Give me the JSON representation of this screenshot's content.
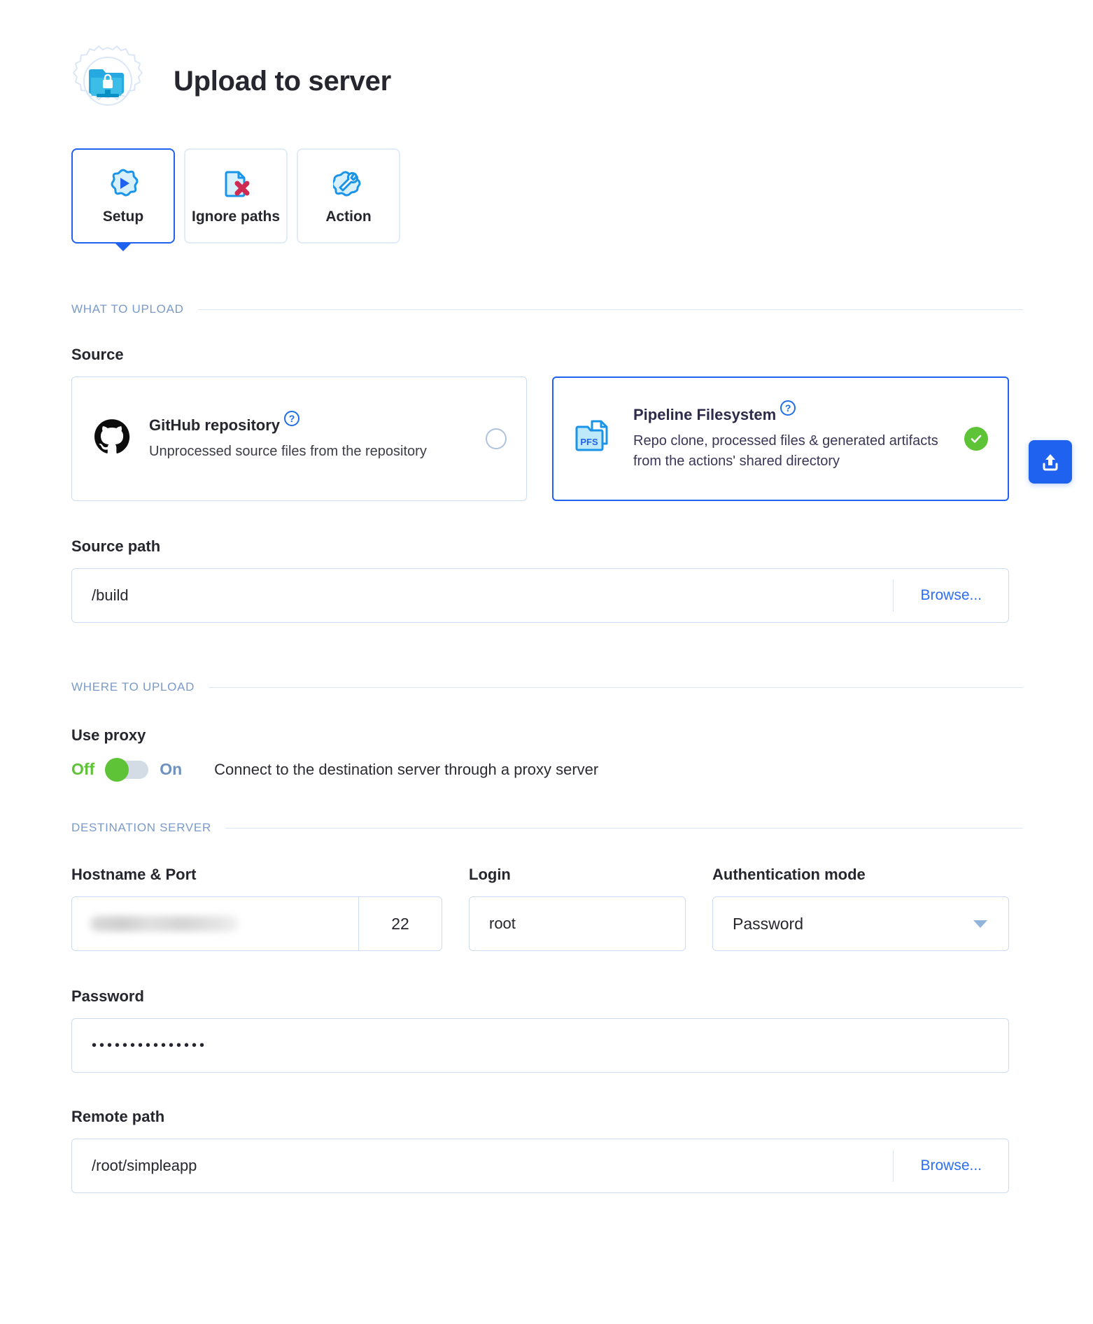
{
  "header": {
    "title": "Upload to server",
    "icon": "upload-to-server-gear-icon"
  },
  "tabs": [
    {
      "label": "Setup",
      "icon": "setup-play-gear-icon",
      "active": true
    },
    {
      "label": "Ignore paths",
      "icon": "file-remove-icon",
      "active": false
    },
    {
      "label": "Action",
      "icon": "action-gear-wrench-icon",
      "active": false
    }
  ],
  "sections": {
    "what_to_upload": "WHAT TO UPLOAD",
    "where_to_upload": "WHERE TO UPLOAD",
    "destination_server": "DESTINATION SERVER"
  },
  "source": {
    "label": "Source",
    "help_symbol": "?",
    "options": [
      {
        "title": "GitHub repository",
        "description": "Unprocessed source files from the repository",
        "icon": "github-octocat-icon",
        "selected": false
      },
      {
        "title": "Pipeline Filesystem",
        "description": "Repo clone, processed files & generated artifacts from the actions' shared directory",
        "description_line1": "Repo clone, processed files & generated",
        "description_line2": "artifacts from the actions' shared directory",
        "icon": "pfs-folder-icon",
        "selected": true
      }
    ]
  },
  "source_path": {
    "label": "Source path",
    "value": "/build",
    "browse_label": "Browse..."
  },
  "use_proxy": {
    "label": "Use proxy",
    "off_label": "Off",
    "on_label": "On",
    "state": "Off",
    "description": "Connect to the destination server through a proxy server"
  },
  "destination": {
    "hostname_port_label": "Hostname & Port",
    "hostname_value": "",
    "port_value": "22",
    "login_label": "Login",
    "login_value": "root",
    "auth_mode_label": "Authentication mode",
    "auth_mode_value": "Password",
    "password_label": "Password",
    "password_value": "•••••••••••••••",
    "remote_path_label": "Remote path",
    "remote_path_value": "/root/simpleapp",
    "browse_label": "Browse..."
  },
  "upload_fab": {
    "icon": "upload-icon"
  },
  "colors": {
    "accent_blue": "#1f62f0",
    "link_blue": "#2b6ef5",
    "section_label": "#7a9bc9",
    "green": "#5ec336",
    "border": "#cddcf1",
    "text_dark": "#26262e"
  }
}
